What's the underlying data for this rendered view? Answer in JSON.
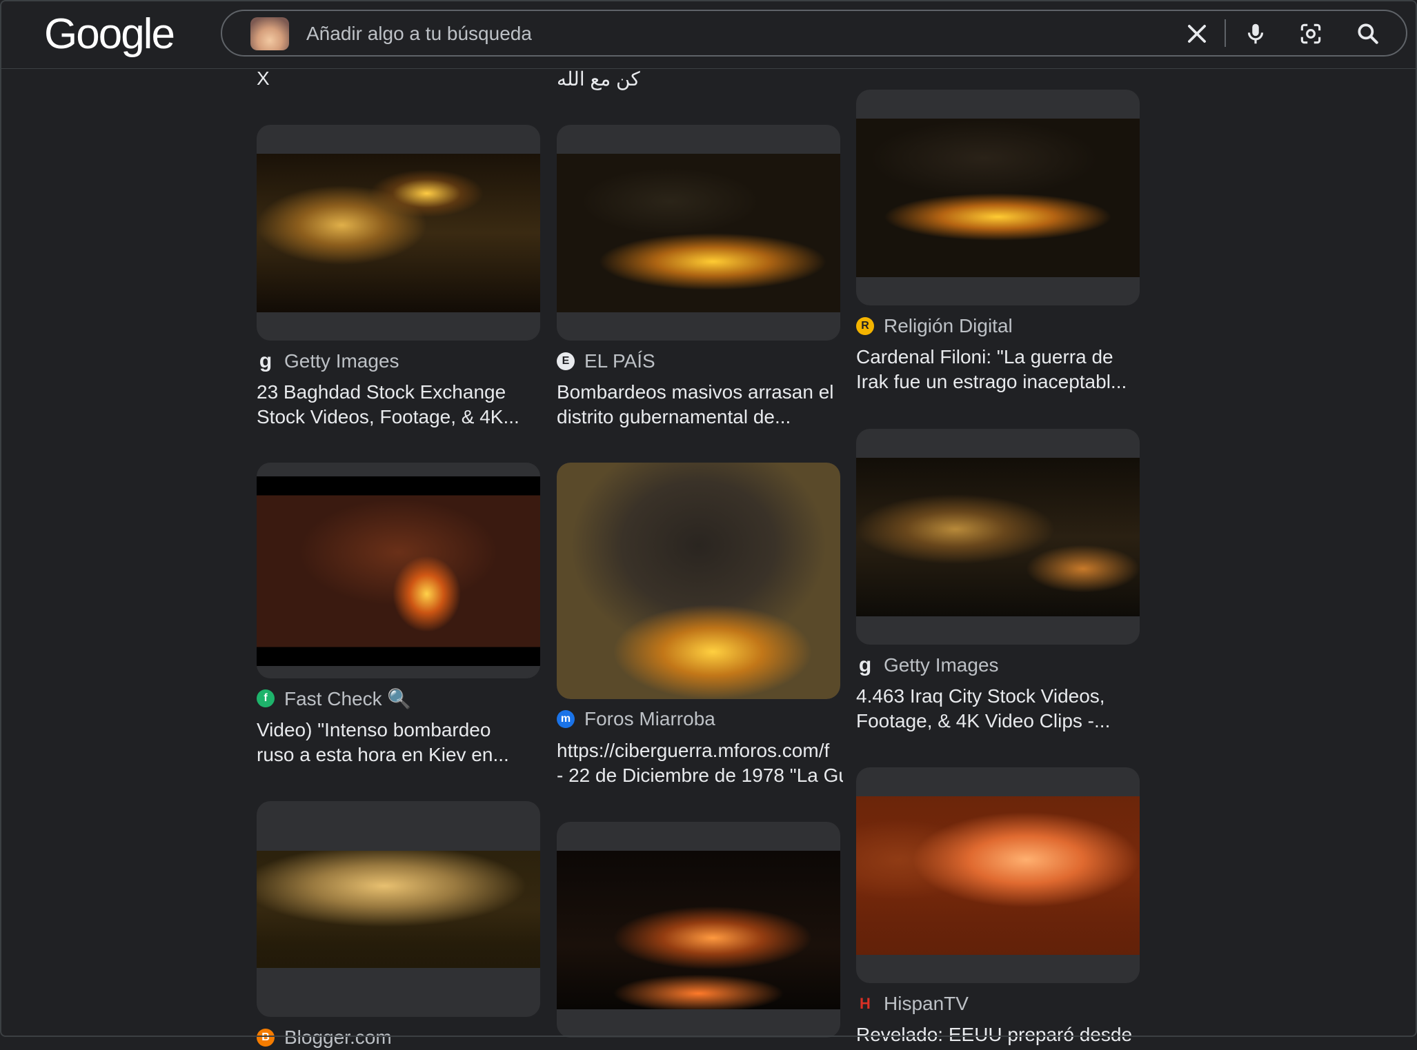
{
  "header": {
    "logo": "Google",
    "search_placeholder": "Añadir algo a tu búsqueda",
    "icons": [
      "image-thumbnail",
      "close-icon",
      "mic-icon",
      "lens-icon",
      "search-icon"
    ]
  },
  "top_fragments": {
    "col1": "X",
    "col2": "كن مع الله"
  },
  "results": {
    "r1": {
      "source": "Getty Images",
      "title_line1": "23 Baghdad Stock Exchange",
      "title_line2": "Stock Videos, Footage, & 4K...",
      "favicon": "g",
      "favicon_color": "#202124"
    },
    "r2": {
      "source": "EL PAÍS",
      "title_line1": "Bombardeos masivos arrasan el",
      "title_line2": "distrito gubernamental de...",
      "favicon": "E",
      "favicon_color": "#ffffff"
    },
    "r3": {
      "source": "Religión Digital",
      "title_line1": "Cardenal Filoni: \"La guerra de",
      "title_line2": "Irak fue un estrago inaceptabl...",
      "favicon": "R",
      "favicon_color": "#f4b400"
    },
    "r4": {
      "source": "Fast Check 🔍",
      "title_line1": "Video) \"Intenso bombardeo",
      "title_line2": "ruso a esta hora en Kiev en...",
      "favicon": "f",
      "favicon_color": "#1eb36b"
    },
    "r5": {
      "source": "Foros Miarroba",
      "title_line1": "https://ciberguerra.mforos.com/f",
      "title_line2": "- 22 de Diciembre de 1978 \"La Gu",
      "favicon": "m",
      "favicon_color": "#1a73e8"
    },
    "r6": {
      "source": "Getty Images",
      "title_line1": "4.463 Iraq City Stock Videos,",
      "title_line2": "Footage, & 4K Video Clips -...",
      "favicon": "g",
      "favicon_color": "#202124"
    },
    "r7": {
      "source": "Blogger.com",
      "favicon": "B",
      "favicon_color": "#f57c00"
    },
    "r9": {
      "source": "HispanTV",
      "title_line1": "Revelado: EEUU preparó desde",
      "favicon": "H",
      "favicon_color": "#d93025"
    }
  }
}
